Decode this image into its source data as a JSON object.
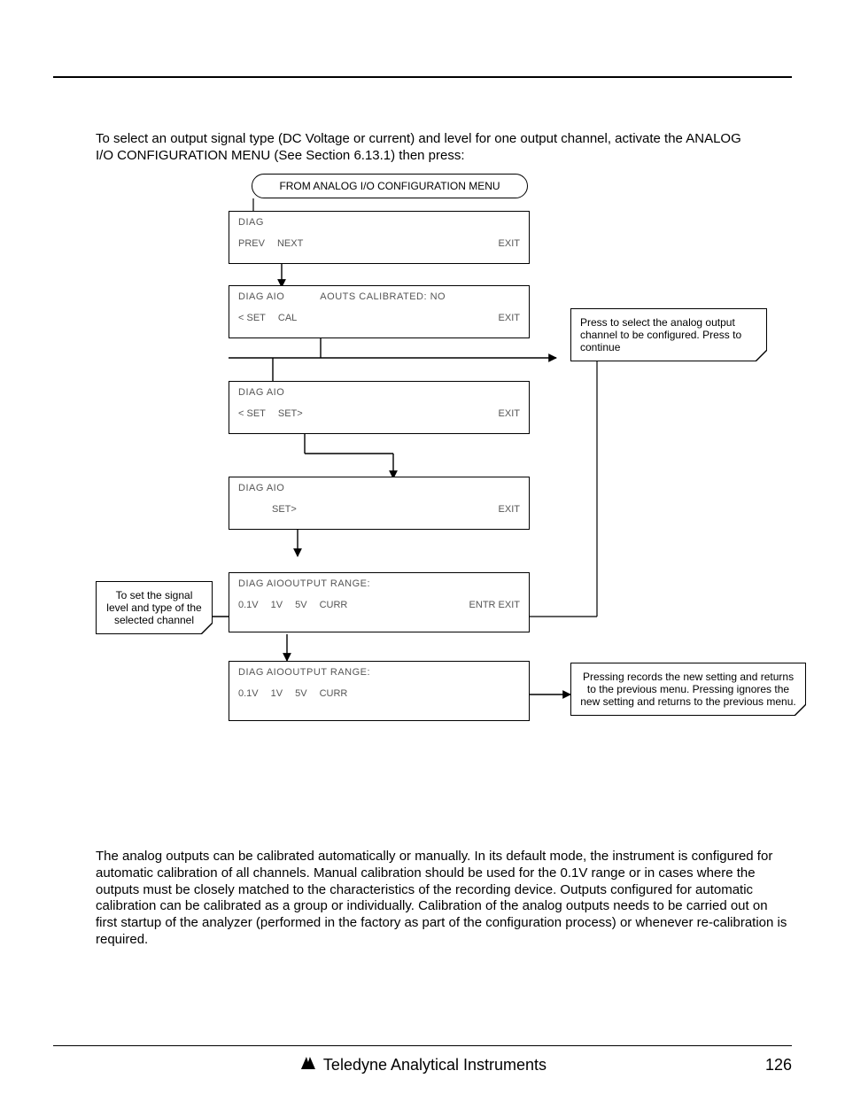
{
  "intro": "To select an output signal type (DC Voltage or current) and level for one output channel, activate the ANALOG I/O CONFIGURATION MENU (See Section 6.13.1) then press:",
  "diagram": {
    "start": "FROM ANALOG I/O CONFIGURATION MENU",
    "panel1": {
      "title": "DIAG",
      "left": [
        "PREV",
        "NEXT"
      ],
      "right": "EXIT"
    },
    "panel2": {
      "title": "DIAG AIO",
      "status": "AOUTS CALIBRATED: NO",
      "left": [
        "< SET",
        "CAL"
      ],
      "right": "EXIT"
    },
    "callout_right1": "Press          to select the analog output channel to be configured. Press          to continue",
    "panel3": {
      "title": "DIAG AIO",
      "left": [
        "< SET",
        "SET>"
      ],
      "right": "EXIT"
    },
    "panel4": {
      "title": "DIAG AIO",
      "left": [
        "SET>"
      ],
      "right": "EXIT"
    },
    "callout_left": "To set the signal level and type of the selected channel",
    "panel5": {
      "title": "DIAG AIO",
      "status_after": "OUTPUT RANGE:",
      "left": [
        "0.1V",
        "1V",
        "5V",
        "CURR"
      ],
      "right": "ENTR  EXIT"
    },
    "panel6": {
      "title": "DIAG AIO",
      "status_after": "OUTPUT RANGE:",
      "left": [
        "0.1V",
        "1V",
        "5V",
        "CURR"
      ],
      "right": ""
    },
    "callout_right2": "Pressing            records the new setting and returns to the previous menu. Pressing            ignores the new setting and returns to the previous menu."
  },
  "body": "The analog outputs can be calibrated automatically or manually.  In its default mode, the instrument is configured for automatic calibration of all channels.  Manual calibration should be used for the 0.1V range or in cases where the outputs must be closely matched to the characteristics of the recording device.  Outputs configured for automatic calibration can be calibrated as a group or individually.  Calibration of the analog outputs needs to be carried out on first startup of the analyzer (performed in the factory as part of the configuration process) or whenever re-calibration is required.",
  "footer": {
    "brand": "Teledyne Analytical Instruments",
    "page": "126"
  }
}
